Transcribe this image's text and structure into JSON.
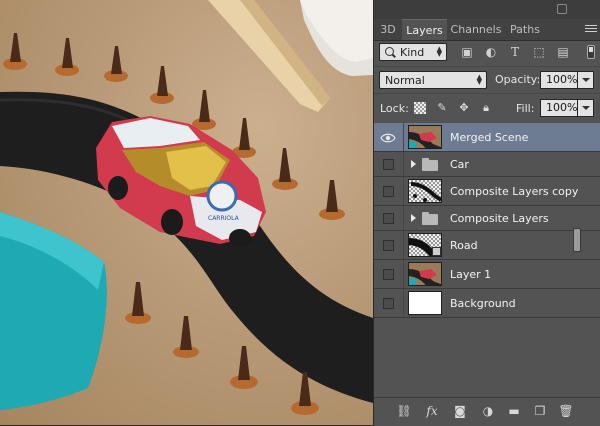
{
  "panel": {
    "tabs": [
      {
        "label": "3D"
      },
      {
        "label": "Layers"
      },
      {
        "label": "Channels"
      },
      {
        "label": "Paths"
      }
    ],
    "filter": {
      "kind_label": "Kind"
    },
    "blend_mode": "Normal",
    "opacity_label": "Opacity:",
    "opacity_value": "100%",
    "lock_label": "Lock:",
    "fill_label": "Fill:",
    "fill_value": "100%",
    "layers": [
      {
        "name": "Merged Scene",
        "selected": true,
        "visible": true
      },
      {
        "name": "Car",
        "group": true
      },
      {
        "name": "Composite Layers copy"
      },
      {
        "name": "Composite Layers",
        "group": true
      },
      {
        "name": "Road"
      },
      {
        "name": "Layer 1"
      },
      {
        "name": "Background"
      }
    ]
  },
  "canvas": {
    "car_sticker_text": "CARRIOLA"
  },
  "icons": {
    "filter": [
      "image-filter-icon",
      "adjustment-filter-icon",
      "type-filter-icon",
      "shape-filter-icon",
      "smart-object-filter-icon"
    ],
    "lock": [
      "lock-transparent-pixels-icon",
      "lock-image-pixels-icon",
      "lock-position-icon",
      "lock-all-icon"
    ],
    "bottom": [
      "link-layers-icon",
      "fx-icon",
      "add-mask-icon",
      "adjustment-layer-icon",
      "new-group-icon",
      "new-layer-icon",
      "trash-icon"
    ]
  },
  "colors": {
    "panel_bg": "#535353",
    "selected_row": "#6d7c93",
    "road": "#1e1e1e",
    "car_red": "#d23a4e",
    "cone": "#4a2a18",
    "turquoise": "#1fa9b3"
  }
}
